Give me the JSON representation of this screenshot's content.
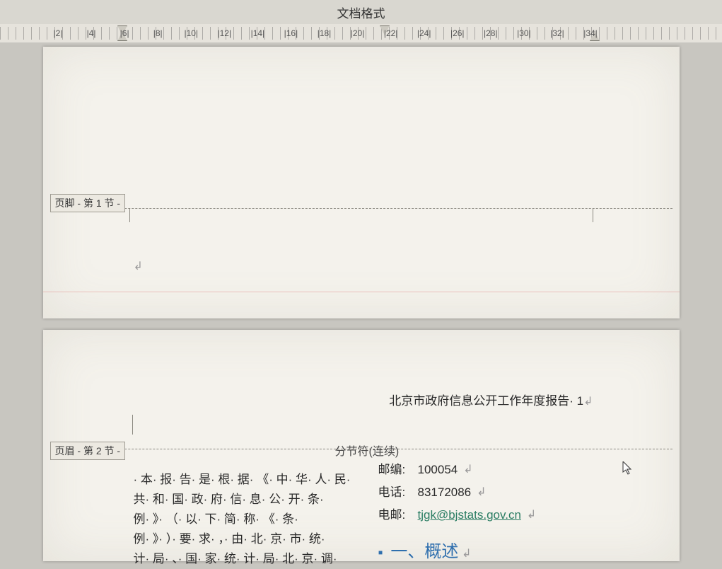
{
  "toolbar": {
    "tab_label": "文档格式"
  },
  "ruler": {
    "labels": [
      "|2|",
      "|4|",
      "|6|",
      "|8|",
      "|10|",
      "|12|",
      "|14|",
      "|16|",
      "|18|",
      "|20|",
      "|22|",
      "|24|",
      "|26|",
      "|28|",
      "|30|",
      "|32|",
      "|34|"
    ]
  },
  "page1": {
    "footer_label": "页脚 - 第 1 节 -",
    "para_mark": "↲"
  },
  "page2": {
    "header_text": "北京市政府信息公开工作年度报告· 1",
    "header_label": "页眉 - 第 2 节 -",
    "section_break": "分节符(连续)",
    "body_left": [
      "· 本· 报· 告· 是· 根· 据· 《· 中· 华· 人· 民·",
      "共· 和· 国· 政· 府· 信· 息· 公· 开· 条·",
      "例· 》· （· 以· 下· 简· 称· 《· 条·",
      "例· 》· ）· 要· 求· ，· 由· 北· 京· 市· 统·",
      "计· 局· 、· 国· 家· 统· 计· 局· 北· 京· 调·"
    ],
    "contact": {
      "postal_label": "邮编:",
      "postal_value": "100054",
      "phone_label": "电话:",
      "phone_value": "83172086",
      "email_label": "电邮:",
      "email_value": "tjgk@bjstats.gov.cn"
    },
    "heading": {
      "bullet": "▪",
      "text": "一、概述"
    },
    "para_mark": "↲"
  }
}
